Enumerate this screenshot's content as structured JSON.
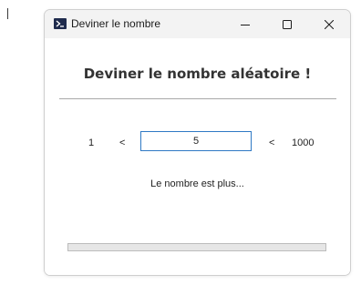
{
  "window": {
    "title": "Deviner le nombre",
    "app_icon": "terminal-icon",
    "controls": {
      "minimize_icon": "minimize-icon",
      "maximize_icon": "maximize-icon",
      "close_icon": "close-icon"
    }
  },
  "main": {
    "heading": "Deviner le nombre aléatoire !",
    "range": {
      "min": "1",
      "lt_left": "<",
      "lt_right": "<",
      "max": "1000"
    },
    "guess_input": {
      "value": "5"
    },
    "hint": "Le nombre est plus..."
  },
  "progress": {
    "fraction": 0
  },
  "colors": {
    "input_border": "#2f79c4",
    "titlebar_bg": "#f3f3f3",
    "progress_track": "#e6e6e6"
  }
}
